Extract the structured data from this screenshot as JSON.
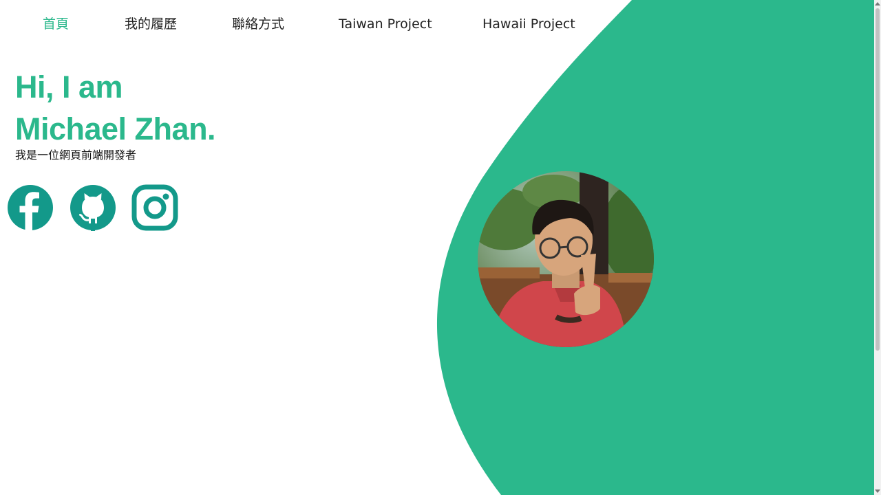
{
  "nav": {
    "items": [
      {
        "label": "首頁",
        "active": true
      },
      {
        "label": "我的履歷",
        "active": false
      },
      {
        "label": "聯絡方式",
        "active": false
      },
      {
        "label": "Taiwan Project",
        "active": false
      },
      {
        "label": "Hawaii Project",
        "active": false
      }
    ]
  },
  "hero": {
    "line1": "Hi, I am",
    "line2": "Michael Zhan.",
    "subtitle": "我是一位網頁前端開發者"
  },
  "social": {
    "icons": [
      "facebook-icon",
      "github-icon",
      "instagram-icon"
    ]
  },
  "colors": {
    "accent": "#2bb88c",
    "social_icon": "#13998a",
    "text": "#111111"
  }
}
